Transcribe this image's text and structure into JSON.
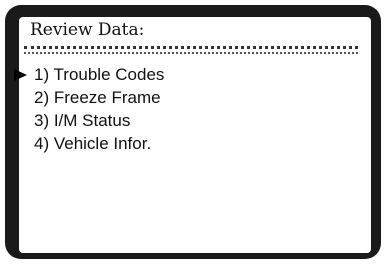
{
  "screen": {
    "title": "Review Data:"
  },
  "menu": {
    "selected_index": 0,
    "items": [
      {
        "label": "1) Trouble Codes"
      },
      {
        "label": "2) Freeze Frame"
      },
      {
        "label": "3) I/M Status"
      },
      {
        "label": "4) Vehicle Infor."
      }
    ]
  },
  "icons": {
    "selection_cursor": "right-pointing-triangle"
  },
  "colors": {
    "frame": "#1a1a1a",
    "screen_background": "#ffffff",
    "text": "#111111"
  }
}
